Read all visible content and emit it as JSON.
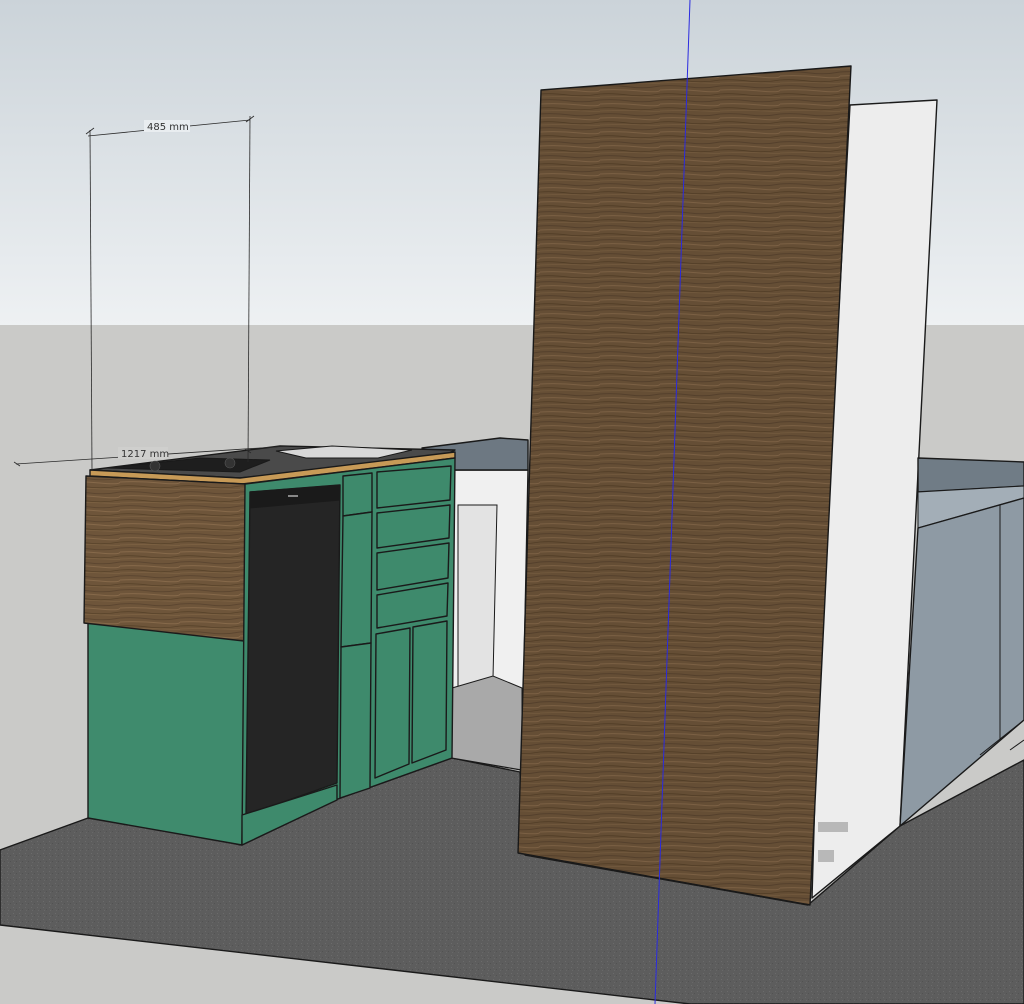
{
  "dimensions": {
    "width_label": "485 mm",
    "length_label": "1217 mm"
  },
  "colors": {
    "sky_top": "#cdd5db",
    "sky_bottom": "#edf1f3",
    "ground": "#c8c8c6",
    "floor": "#5f5f5f",
    "cabinet_green": "#3e8a6c",
    "cabinet_green_dark": "#2f6f56",
    "wood_dark": "#6b5238",
    "wood_light": "#866a4a",
    "fridge": "#262626",
    "wall_white": "#ececec",
    "side_cabinet": "#8d99a3",
    "side_cabinet_top": "#6f7c86",
    "axis_blue": "#2222dd",
    "axis_red": "#dd2222"
  }
}
